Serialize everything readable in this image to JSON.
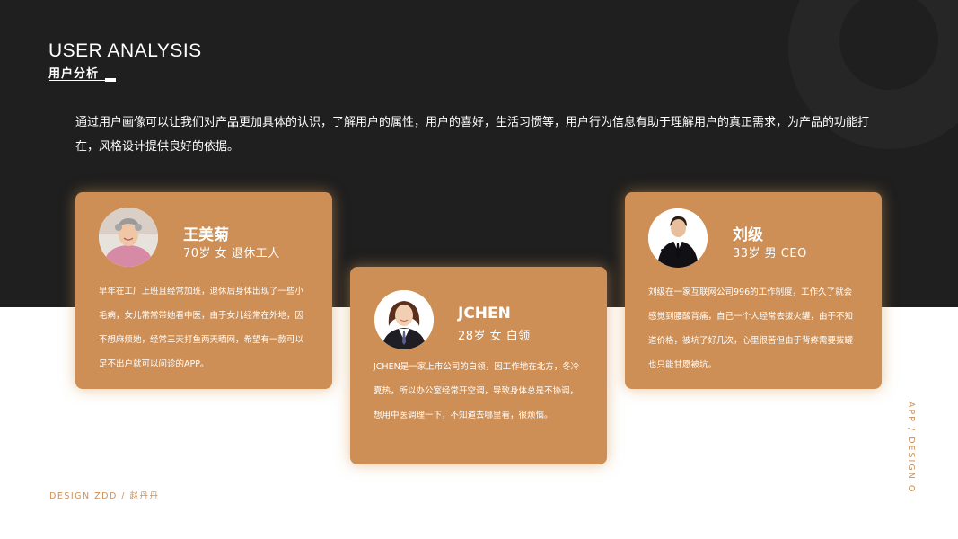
{
  "header": {
    "title_en": "USER ANALYSIS",
    "title_cn": "用户分析"
  },
  "intro": "通过用户画像可以让我们对产品更加具体的认识，了解用户的属性，用户的喜好，生活习惯等，用户行为信息有助于理解用户的真正需求，为产品的功能打在，风格设计提供良好的依据。",
  "users": [
    {
      "name": "王美菊",
      "meta": "70岁  女  退休工人",
      "avatar_icon": "elderly-woman-avatar-icon",
      "desc": "早年在工厂上班且经常加班，退休后身体出现了一些小毛病，女儿常常带她看中医，由于女儿经常在外地，因不想麻烦她，经常三天打鱼两天晒网，希望有一款可以足不出户就可以问诊的APP。"
    },
    {
      "name": "JCHEN",
      "meta": "28岁  女  白领",
      "avatar_icon": "businesswoman-avatar-icon",
      "desc": "JCHEN是一家上市公司的白领，因工作地在北方，冬冷夏热，所以办公室经常开空调，导致身体总是不协调，想用中医调理一下，不知道去哪里看，很烦恼。"
    },
    {
      "name": "刘级",
      "meta": "33岁  男  CEO",
      "avatar_icon": "businessman-avatar-icon",
      "desc": "刘级在一家互联网公司996的工作制度，工作久了就会感觉到腰酸背痛，自己一个人经常去拔火罐，由于不知道价格，被坑了好几次，心里很苦但由于背疼需要拔罐也只能甘愿被坑。"
    }
  ],
  "footer": {
    "left": "DESIGN ZDD / 赵丹丹",
    "right_vertical": "APP / DESIGN O"
  },
  "colors": {
    "dark_band": "#1f1f1f",
    "accent": "#cd8f55",
    "text_light": "#ffffff"
  }
}
